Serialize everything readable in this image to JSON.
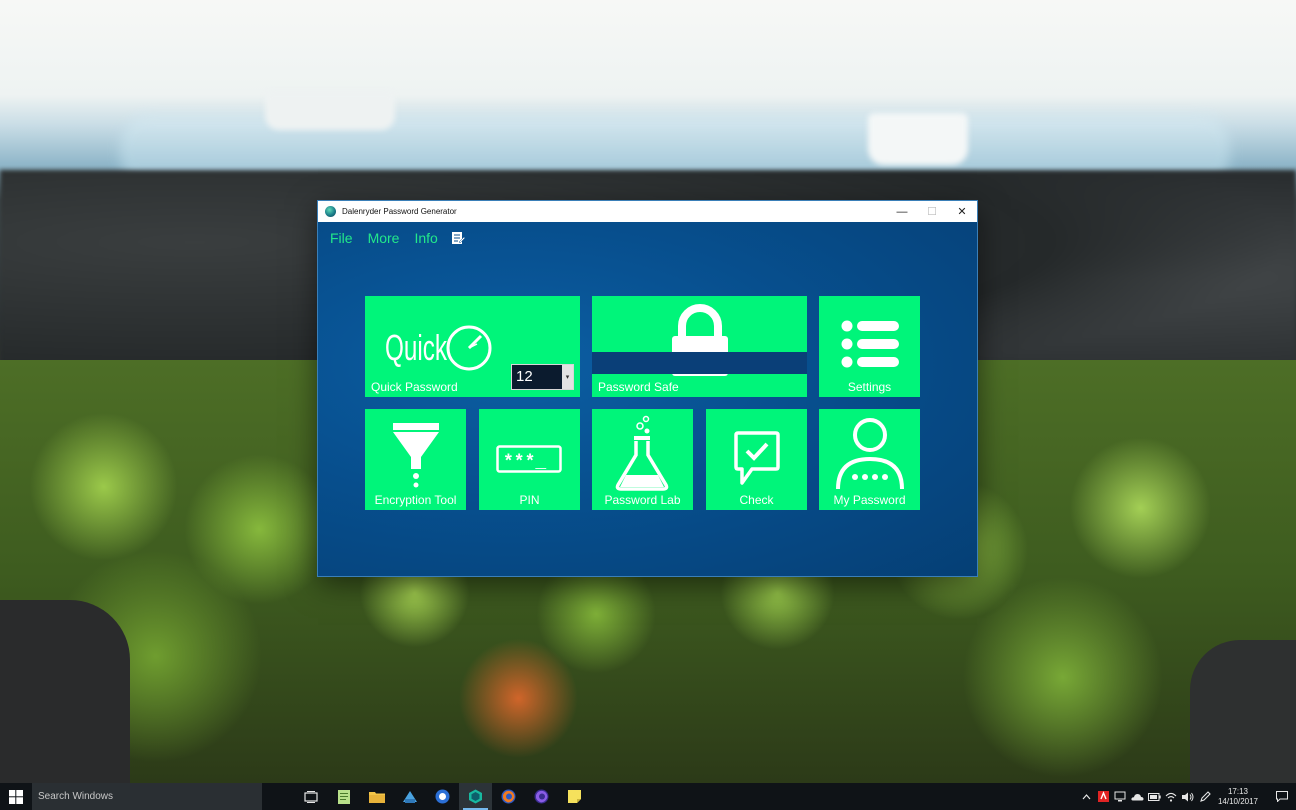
{
  "window": {
    "title": "Dalenryder Password Generator",
    "minimize_glyph": "—",
    "maximize_glyph": "☐",
    "close_glyph": "✕"
  },
  "menu": {
    "file": "File",
    "more": "More",
    "info": "Info",
    "notes_icon": "notepad-icon"
  },
  "tiles": {
    "quick_password": {
      "label": "Quick Password",
      "logo_text": "Quick",
      "length_value": "12",
      "spin_glyph": "▾"
    },
    "password_safe": {
      "label": "Password Safe"
    },
    "settings": {
      "label": "Settings"
    },
    "encryption_tool": {
      "label": "Encryption Tool"
    },
    "pin": {
      "label": "PIN",
      "icon_text": "***_"
    },
    "password_lab": {
      "label": "Password Lab"
    },
    "check": {
      "label": "Check"
    },
    "my_password": {
      "label": "My Password"
    }
  },
  "colors": {
    "tile_green": "#00f57a",
    "menu_green": "#22e88a",
    "window_blue": "#0a4f8c"
  },
  "taskbar": {
    "search_placeholder": "Search Windows",
    "time": "17:13",
    "date": "14/10/2017",
    "pinned_icons": [
      "task-view-icon",
      "notepad-icon",
      "file-explorer-icon",
      "app-icon",
      "browser-icon",
      "password-generator-icon",
      "firefox-icon",
      "firefox-nightly-icon",
      "sticky-notes-icon"
    ],
    "tray_icons": [
      "chevron-up-icon",
      "antivirus-icon",
      "network-icon",
      "onedrive-icon",
      "battery-icon",
      "wifi-icon",
      "volume-icon",
      "pen-icon"
    ]
  }
}
